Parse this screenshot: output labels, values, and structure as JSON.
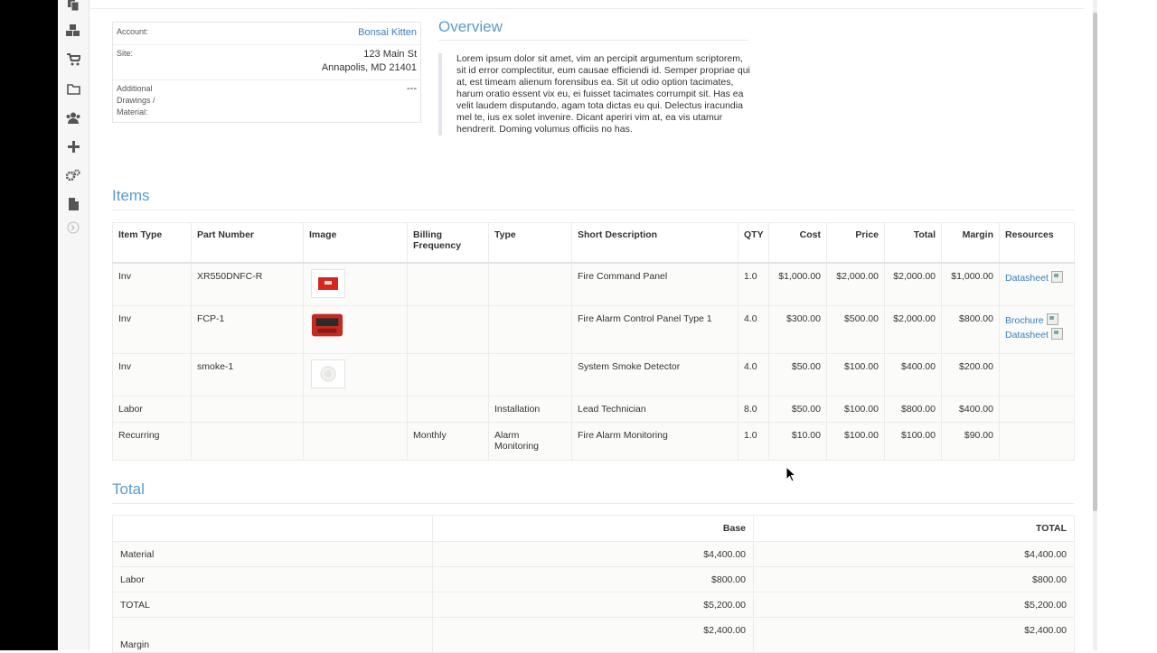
{
  "sidebar": {
    "icons": [
      "copy-icon",
      "cubes-icon",
      "cart-icon",
      "folder-icon",
      "users-icon",
      "plus-icon",
      "cogs-icon",
      "file-icon",
      "collapse-icon"
    ]
  },
  "account": {
    "account_label": "Account:",
    "account_value": "Bonsai Kitten",
    "site_label": "Site:",
    "site_line1": "123 Main St",
    "site_line2": "Annapolis, MD 21401",
    "additional_label_1": "Additional",
    "additional_label_2": "Drawings /",
    "additional_label_3": "Material:",
    "additional_value": "---"
  },
  "overview": {
    "title": "Overview",
    "text": "Lorem ipsum dolor sit amet, vim an percipit argumentum scriptorem, sit id error complectitur, eum causae efficiendi id. Semper propriae qui at, est timeam alienum forensibus ea. Sit ut odio option tacimates, harum oratio essent vix eu, ei fuisset tacimates corrumpit sit. Has ea velit laudem disputando, agam tota dictas eu qui. Delectus iracundia mel te, ius ex solet invenire. Dicant aperiri vim at, ea vis utamur hendrerit. Doming volumus officiis no has."
  },
  "items": {
    "title": "Items",
    "columns": {
      "item_type": "Item Type",
      "part_number": "Part Number",
      "image": "Image",
      "billing_1": "Billing",
      "billing_2": "Frequency",
      "type": "Type",
      "short_description": "Short Description",
      "qty": "QTY",
      "cost": "Cost",
      "price": "Price",
      "total": "Total",
      "margin": "Margin",
      "resources": "Resources"
    },
    "rows": [
      {
        "item_type": "Inv",
        "part_number": "XR550DNFC-R",
        "image": "fire-command-panel-thumbnail",
        "billing": "",
        "type": "",
        "type2": "",
        "desc": "Fire Command Panel",
        "qty": "1.0",
        "cost": "$1,000.00",
        "price": "$2,000.00",
        "total": "$2,000.00",
        "margin": "$1,000.00",
        "res1": "Datasheet",
        "res2": ""
      },
      {
        "item_type": "Inv",
        "part_number": "FCP-1",
        "image": "fire-alarm-panel-thumbnail",
        "billing": "",
        "type": "",
        "type2": "",
        "desc": "Fire Alarm Control Panel Type 1",
        "qty": "4.0",
        "cost": "$300.00",
        "price": "$500.00",
        "total": "$2,000.00",
        "margin": "$800.00",
        "res1": "Brochure",
        "res2": "Datasheet"
      },
      {
        "item_type": "Inv",
        "part_number": "smoke-1",
        "image": "smoke-detector-thumbnail",
        "billing": "",
        "type": "",
        "type2": "",
        "desc": "System Smoke Detector",
        "qty": "4.0",
        "cost": "$50.00",
        "price": "$100.00",
        "total": "$400.00",
        "margin": "$200.00",
        "res1": "",
        "res2": ""
      },
      {
        "item_type": "Labor",
        "part_number": "",
        "image": "",
        "billing": "",
        "type": "Installation",
        "type2": "",
        "desc": "Lead Technician",
        "qty": "8.0",
        "cost": "$50.00",
        "price": "$100.00",
        "total": "$800.00",
        "margin": "$400.00",
        "res1": "",
        "res2": ""
      },
      {
        "item_type": "Recurring",
        "part_number": "",
        "image": "",
        "billing": "Monthly",
        "type": "Alarm",
        "type2": "Monitoring",
        "desc": "Fire Alarm Monitoring",
        "qty": "1.0",
        "cost": "$10.00",
        "price": "$100.00",
        "total": "$100.00",
        "margin": "$90.00",
        "res1": "",
        "res2": ""
      }
    ]
  },
  "totals": {
    "title": "Total",
    "col_base": "Base",
    "col_total": "TOTAL",
    "rows": [
      {
        "label": "Material",
        "base": "$4,400.00",
        "total": "$4,400.00"
      },
      {
        "label": "Labor",
        "base": "$800.00",
        "total": "$800.00"
      },
      {
        "label": "TOTAL",
        "base": "$5,200.00",
        "total": "$5,200.00"
      },
      {
        "label": "Margin",
        "base": "$2,400.00",
        "total": "$2,400.00"
      }
    ]
  },
  "colors": {
    "accent": "#5a9bcf",
    "link": "#3a7ebf"
  }
}
